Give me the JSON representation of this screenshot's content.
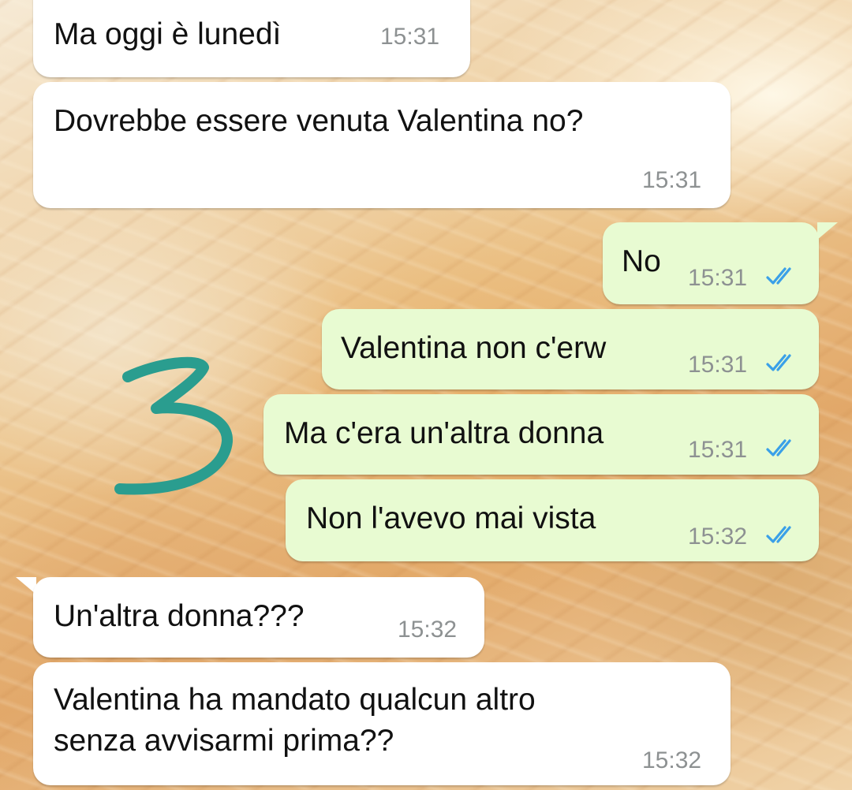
{
  "chat": {
    "messages": [
      {
        "direction": "incoming",
        "text": "Ma oggi è lunedì",
        "time": "15:31"
      },
      {
        "direction": "incoming",
        "text": "Dovrebbe essere venuta Valentina no?",
        "time": "15:31"
      },
      {
        "direction": "outgoing",
        "text": "No",
        "time": "15:31",
        "read_status": "read-double-check-icon"
      },
      {
        "direction": "outgoing",
        "text": "Valentina non c'erw",
        "time": "15:31",
        "read_status": "read-double-check-icon"
      },
      {
        "direction": "outgoing",
        "text": "Ma c'era un'altra donna",
        "time": "15:31",
        "read_status": "read-double-check-icon"
      },
      {
        "direction": "outgoing",
        "text": "Non l'avevo mai vista",
        "time": "15:32",
        "read_status": "read-double-check-icon"
      },
      {
        "direction": "incoming",
        "text": "Un'altra donna???",
        "time": "15:32"
      },
      {
        "direction": "incoming",
        "text": "Valentina ha mandato qualcun altro\nsenza avvisarmi prima??",
        "time": "15:32"
      }
    ]
  },
  "annotation": {
    "text": "3",
    "color": "#2a9d8f"
  },
  "colors": {
    "incoming_bubble": "#ffffff",
    "outgoing_bubble": "#e8fbd2",
    "read_ticks": "#3aa0e8",
    "timestamp": "#8d9192"
  }
}
